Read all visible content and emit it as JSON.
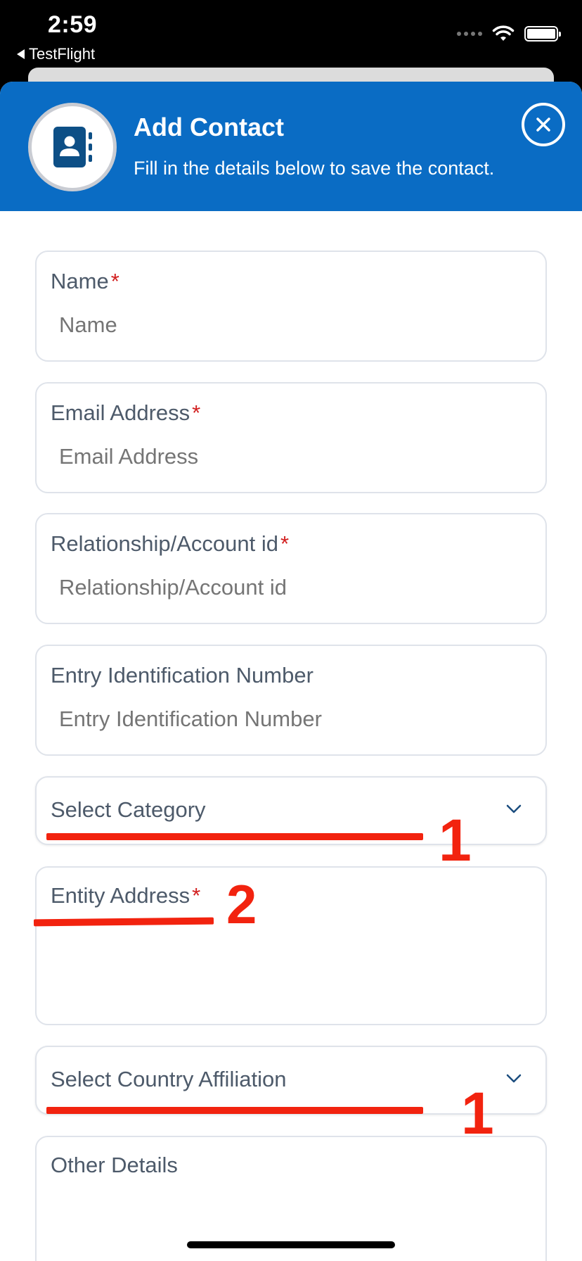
{
  "status_bar": {
    "time": "2:59",
    "back_app": "TestFlight"
  },
  "header": {
    "title": "Add Contact",
    "subtitle": "Fill in the details below to save the contact.",
    "accent_color": "#0a6cc4"
  },
  "form": {
    "name": {
      "label": "Name",
      "required_mark": "*",
      "placeholder": "Name"
    },
    "email": {
      "label": "Email Address",
      "required_mark": "*",
      "placeholder": "Email Address"
    },
    "relationship": {
      "label": "Relationship/Account id",
      "required_mark": "*",
      "placeholder": "Relationship/Account id"
    },
    "entry_id": {
      "label": "Entry Identification Number",
      "placeholder": "Entry Identification Number"
    },
    "category": {
      "selected": "Select Category"
    },
    "entity_address": {
      "label": "Entity Address",
      "required_mark": "*"
    },
    "country": {
      "selected": "Select Country Affiliation"
    },
    "other_details": {
      "label": "Other Details"
    }
  },
  "annotations": {
    "category_mark": "1",
    "entity_address_mark": "2",
    "country_mark": "1",
    "color": "#f2230f"
  },
  "icons": {
    "contact_book": "contact-book-icon",
    "close": "close-icon",
    "chevron": "chevron-down-icon",
    "wifi": "wifi-icon",
    "battery": "battery-icon"
  }
}
